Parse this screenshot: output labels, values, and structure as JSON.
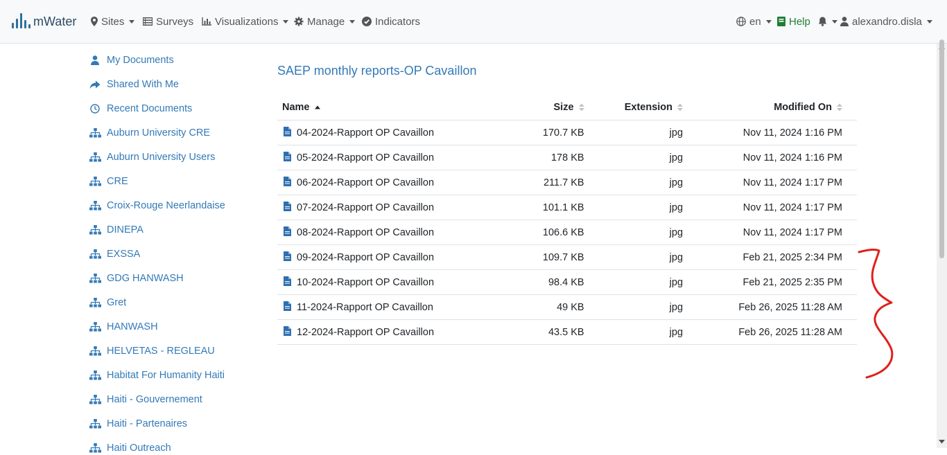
{
  "navbar": {
    "brand": "mWater",
    "items": [
      {
        "label": "Sites",
        "icon": "map-marker-icon",
        "dropdown": true
      },
      {
        "label": "Surveys",
        "icon": "table-icon",
        "dropdown": false
      },
      {
        "label": "Visualizations",
        "icon": "bar-chart-icon",
        "dropdown": true
      },
      {
        "label": "Manage",
        "icon": "gear-icon",
        "dropdown": true
      },
      {
        "label": "Indicators",
        "icon": "check-circle-icon",
        "dropdown": false
      }
    ],
    "language": "en",
    "help": "Help",
    "user": "alexandro.disla"
  },
  "sidebar": {
    "items": [
      {
        "label": "My Documents",
        "icon": "user-icon"
      },
      {
        "label": "Shared With Me",
        "icon": "share-icon"
      },
      {
        "label": "Recent Documents",
        "icon": "clock-icon"
      },
      {
        "label": "Auburn University CRE",
        "icon": "sitemap-icon"
      },
      {
        "label": "Auburn University Users",
        "icon": "sitemap-icon"
      },
      {
        "label": "CRE",
        "icon": "sitemap-icon"
      },
      {
        "label": "Croix-Rouge Neerlandaise",
        "icon": "sitemap-icon"
      },
      {
        "label": "DINEPA",
        "icon": "sitemap-icon"
      },
      {
        "label": "EXSSA",
        "icon": "sitemap-icon"
      },
      {
        "label": "GDG HANWASH",
        "icon": "sitemap-icon"
      },
      {
        "label": "Gret",
        "icon": "sitemap-icon"
      },
      {
        "label": "HANWASH",
        "icon": "sitemap-icon"
      },
      {
        "label": "HELVETAS - REGLEAU",
        "icon": "sitemap-icon"
      },
      {
        "label": "Habitat For Humanity Haiti",
        "icon": "sitemap-icon"
      },
      {
        "label": "Haiti - Gouvernement",
        "icon": "sitemap-icon"
      },
      {
        "label": "Haiti - Partenaires",
        "icon": "sitemap-icon"
      },
      {
        "label": "Haiti Outreach",
        "icon": "sitemap-icon"
      }
    ]
  },
  "folder": {
    "title": "SAEP monthly reports-OP Cavaillon"
  },
  "table": {
    "headers": {
      "name": "Name",
      "size": "Size",
      "extension": "Extension",
      "modified": "Modified On"
    },
    "rows": [
      {
        "name": "04-2024-Rapport OP Cavaillon",
        "size": "170.7 KB",
        "ext": "jpg",
        "modified": "Nov 11, 2024 1:16 PM"
      },
      {
        "name": "05-2024-Rapport OP Cavaillon",
        "size": "178 KB",
        "ext": "jpg",
        "modified": "Nov 11, 2024 1:16 PM"
      },
      {
        "name": "06-2024-Rapport OP Cavaillon",
        "size": "211.7 KB",
        "ext": "jpg",
        "modified": "Nov 11, 2024 1:17 PM"
      },
      {
        "name": "07-2024-Rapport OP Cavaillon",
        "size": "101.1 KB",
        "ext": "jpg",
        "modified": "Nov 11, 2024 1:17 PM"
      },
      {
        "name": "08-2024-Rapport OP Cavaillon",
        "size": "106.6 KB",
        "ext": "jpg",
        "modified": "Nov 11, 2024 1:17 PM"
      },
      {
        "name": "09-2024-Rapport OP Cavaillon",
        "size": "109.7 KB",
        "ext": "jpg",
        "modified": "Feb 21, 2025 2:34 PM"
      },
      {
        "name": "10-2024-Rapport OP Cavaillon",
        "size": "98.4 KB",
        "ext": "jpg",
        "modified": "Feb 21, 2025 2:35 PM"
      },
      {
        "name": "11-2024-Rapport OP Cavaillon",
        "size": "49 KB",
        "ext": "jpg",
        "modified": "Feb 26, 2025 11:28 AM"
      },
      {
        "name": "12-2024-Rapport OP Cavaillon",
        "size": "43.5 KB",
        "ext": "jpg",
        "modified": "Feb 26, 2025 11:28 AM"
      }
    ]
  },
  "colors": {
    "link": "#337ab7",
    "help": "#1e7e34",
    "annotation": "#e0201b"
  }
}
